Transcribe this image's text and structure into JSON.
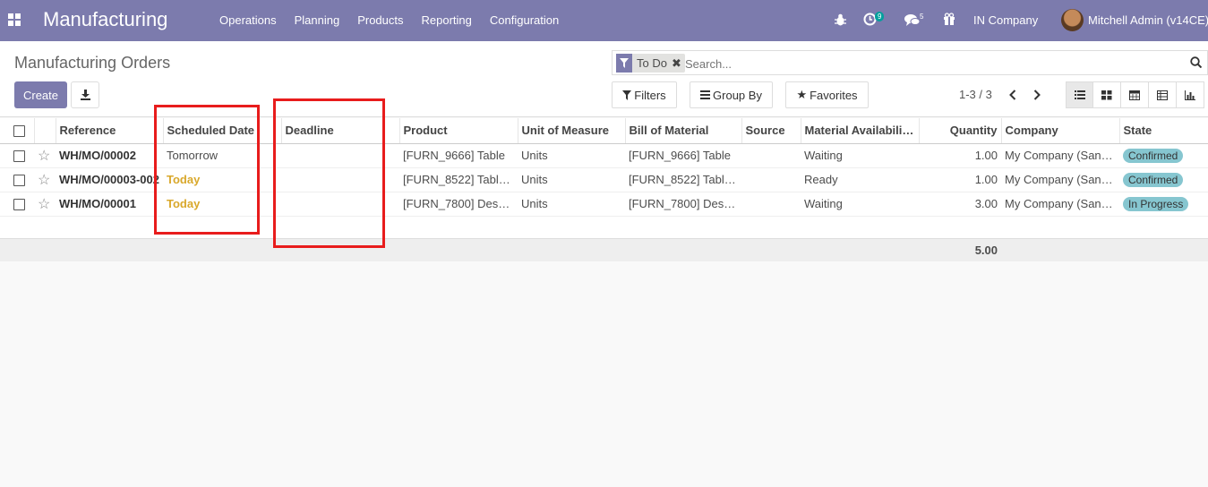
{
  "navbar": {
    "brand": "Manufacturing",
    "menu": [
      "Operations",
      "Planning",
      "Products",
      "Reporting",
      "Configuration"
    ],
    "activity_count": "9",
    "message_count": "5",
    "company": "IN Company",
    "user": "Mitchell Admin (v14CE)"
  },
  "control_panel": {
    "title": "Manufacturing Orders",
    "create_label": "Create",
    "search_facet": "To Do",
    "search_placeholder": "Search...",
    "filters_label": "Filters",
    "group_by_label": "Group By",
    "favorites_label": "Favorites",
    "pager": "1-3 / 3"
  },
  "table": {
    "columns": [
      "Reference",
      "Scheduled Date",
      "Deadline",
      "Product",
      "Unit of Measure",
      "Bill of Material",
      "Source",
      "Material Availabili…",
      "Quantity",
      "Company",
      "State"
    ],
    "rows": [
      {
        "reference": "WH/MO/00002",
        "scheduled": "Tomorrow",
        "deadline": "",
        "product": "[FURN_9666] Table",
        "uom": "Units",
        "bom": "[FURN_9666] Table",
        "source": "",
        "availability": "Waiting",
        "quantity": "1.00",
        "company": "My Company (San …",
        "state": "Confirmed"
      },
      {
        "reference": "WH/MO/00003-002",
        "scheduled": "Today",
        "deadline": "",
        "product": "[FURN_8522] Tabl…",
        "uom": "Units",
        "bom": "[FURN_8522] Tabl…",
        "source": "",
        "availability": "Ready",
        "quantity": "1.00",
        "company": "My Company (San …",
        "state": "Confirmed"
      },
      {
        "reference": "WH/MO/00001",
        "scheduled": "Today",
        "deadline": "",
        "product": "[FURN_7800] Des…",
        "uom": "Units",
        "bom": "[FURN_7800] Des…",
        "source": "",
        "availability": "Waiting",
        "quantity": "3.00",
        "company": "My Company (San …",
        "state": "In Progress"
      }
    ],
    "total_quantity": "5.00"
  },
  "colors": {
    "brand": "#7c7bad",
    "today": "#d9a82b",
    "state_badge": "#86c6d0",
    "annotation": "#e81c1c"
  }
}
